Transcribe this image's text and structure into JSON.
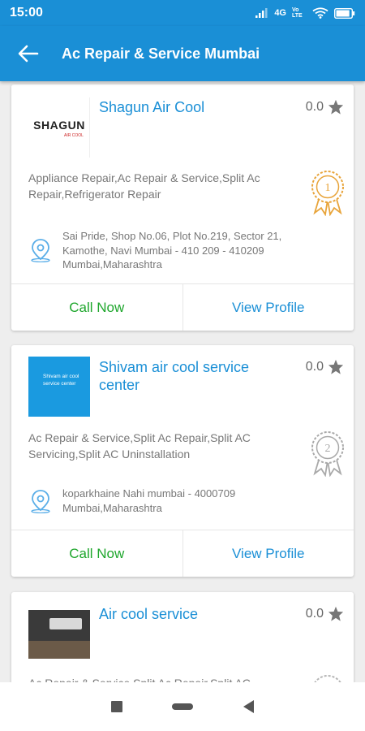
{
  "status": {
    "time": "15:00",
    "network": "4G",
    "lte_badge": "Vo LTE",
    "battery_level": 0.9
  },
  "header": {
    "title": "Ac Repair & Service Mumbai"
  },
  "listings": [
    {
      "name": "Shagun Air Cool",
      "logo_text": "SHAGUN",
      "logo_subtext": "AIR COOL",
      "rating": "0.0",
      "categories": "Appliance Repair,Ac Repair & Service,Split Ac Repair,Refrigerator Repair",
      "rank": "1",
      "address": "Sai Pride, Shop No.06, Plot No.219, Sector 21, Kamothe, Navi Mumbai - 410 209 - 410209 Mumbai,Maharashtra",
      "call_label": "Call Now",
      "profile_label": "View Profile"
    },
    {
      "name": "Shivam air cool service center",
      "logo_text": "Shivam air cool service center",
      "rating": "0.0",
      "categories": "Ac Repair & Service,Split Ac Repair,Split AC Servicing,Split AC Uninstallation",
      "rank": "2",
      "address": "koparkhaine  Nahi mumbai - 4000709 Mumbai,Maharashtra",
      "call_label": "Call Now",
      "profile_label": "View Profile"
    },
    {
      "name": "Air cool service",
      "rating": "0.0",
      "categories": "Ac Repair & Service,Split Ac Repair,Split AC"
    }
  ],
  "colors": {
    "primary": "#1a8fd6",
    "call": "#1ea62c",
    "gold": "#e8a43a",
    "star": "#777777"
  }
}
